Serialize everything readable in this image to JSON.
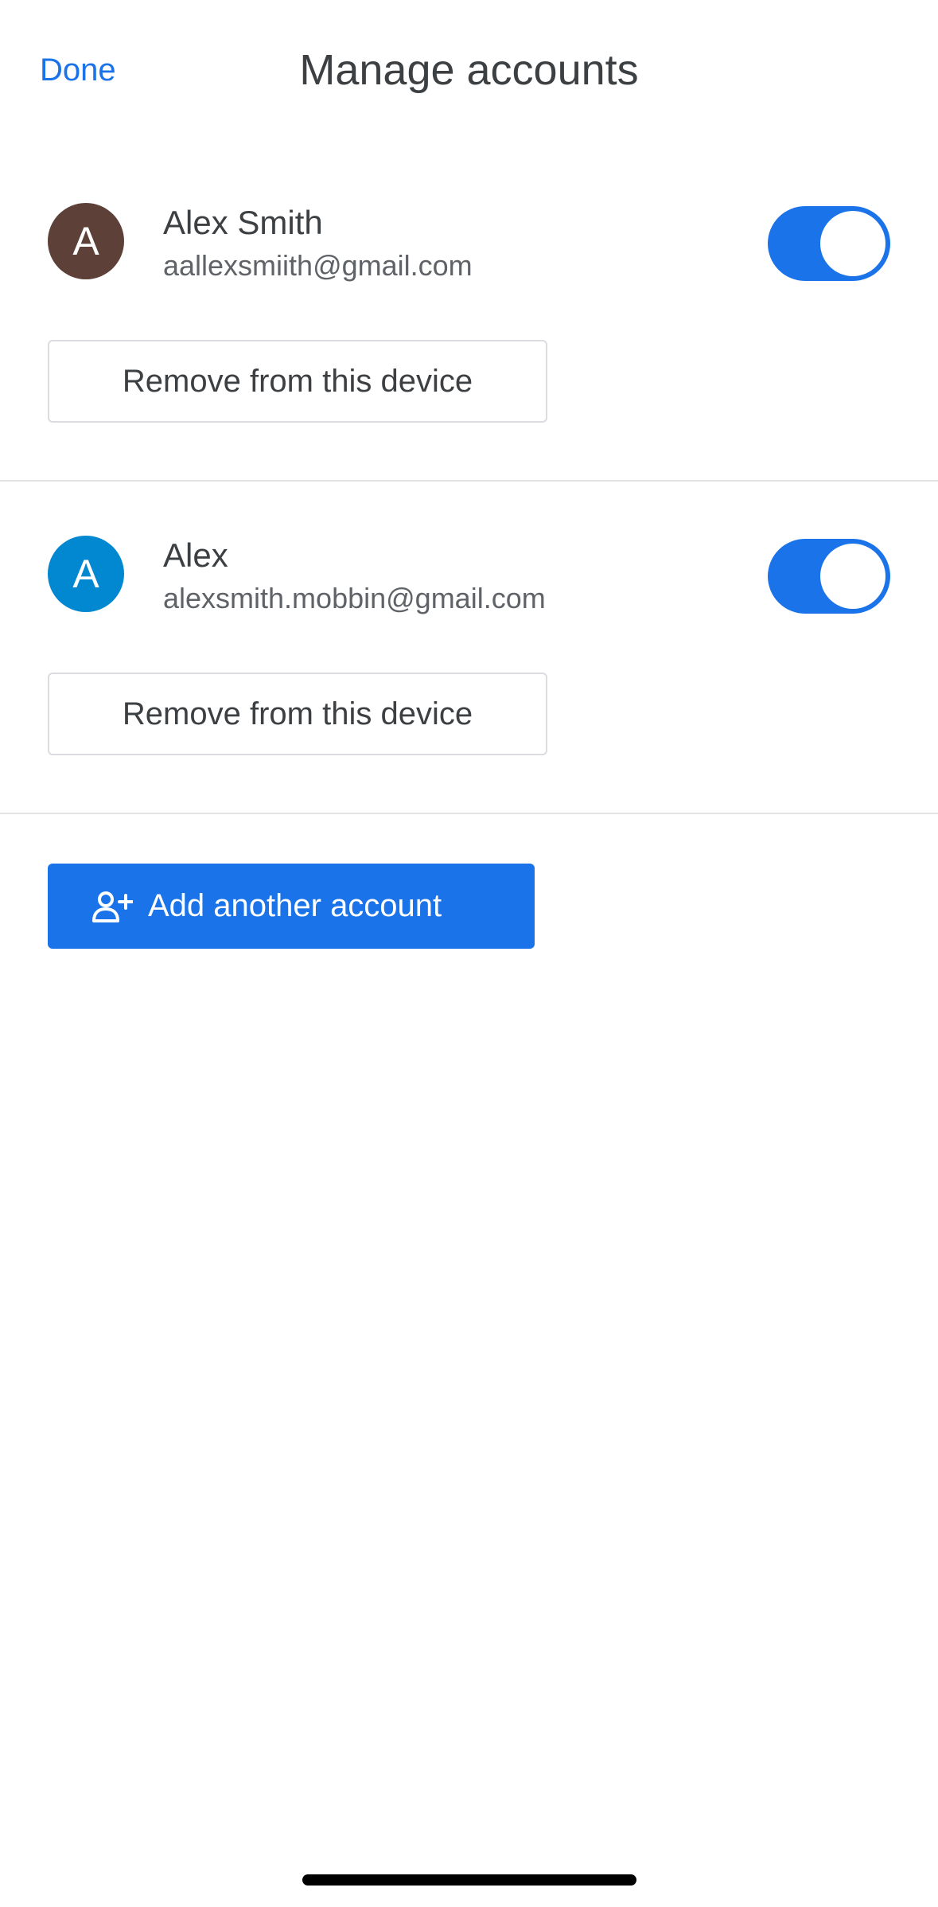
{
  "header": {
    "done_label": "Done",
    "title": "Manage accounts"
  },
  "accounts": [
    {
      "avatar_letter": "A",
      "avatar_color": "#5d4037",
      "name": "Alex Smith",
      "email": "aallexsmiith@gmail.com",
      "toggle_on": true,
      "remove_label": "Remove from this device"
    },
    {
      "avatar_letter": "A",
      "avatar_color": "#0288d1",
      "name": "Alex",
      "email": "alexsmith.mobbin@gmail.com",
      "toggle_on": true,
      "remove_label": "Remove from this device"
    }
  ],
  "add_account": {
    "icon": "person-add-icon",
    "label": "Add another account"
  },
  "colors": {
    "accent": "#1a73e8",
    "divider": "#e3e3e3"
  }
}
